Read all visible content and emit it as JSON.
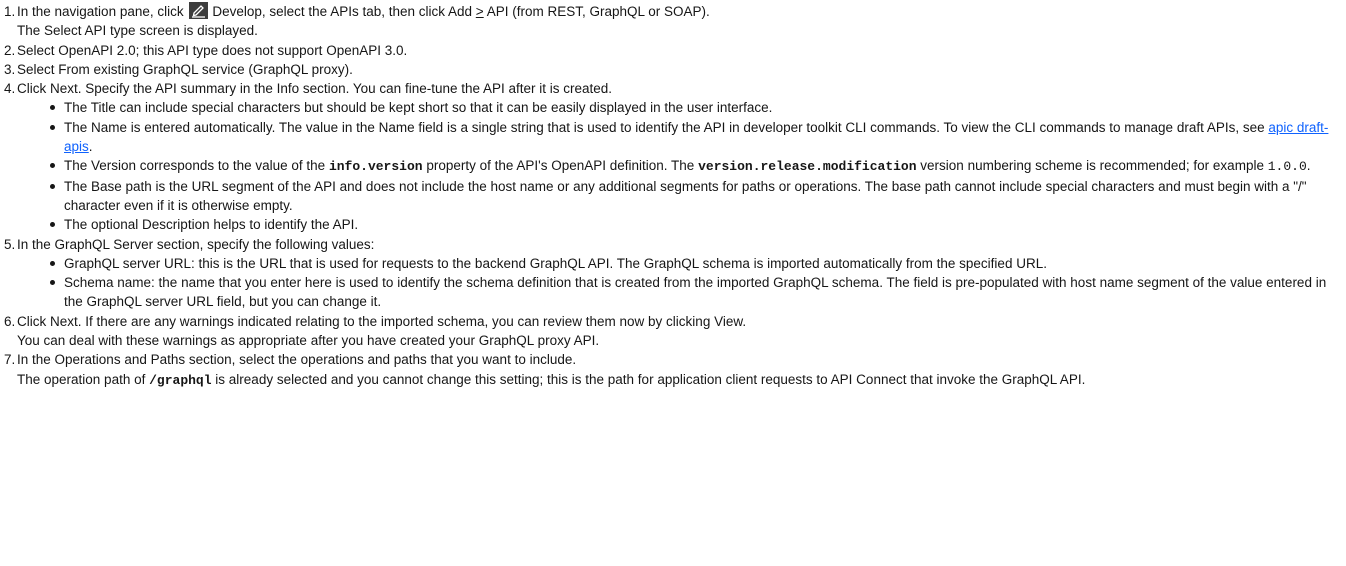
{
  "icons": {
    "develop": "pencil-icon"
  },
  "steps": [
    {
      "num": "1.",
      "t1": "In the navigation pane, click",
      "t2": "Develop, select the APIs tab, then click Add",
      "t3": ">",
      "t4": "API (from REST, GraphQL or SOAP).",
      "line2": "The Select API type screen is displayed."
    },
    {
      "num": "2.",
      "text": "Select OpenAPI 2.0; this API type does not support OpenAPI 3.0."
    },
    {
      "num": "3.",
      "text": "Select From existing GraphQL service (GraphQL proxy)."
    },
    {
      "num": "4.",
      "text": "Click Next. Specify the API summary in the Info section. You can fine-tune the API after it is created.",
      "bullets": {
        "title": "The Title can include special characters but should be kept short so that it can be easily displayed in the user interface.",
        "name_pre": "The Name is entered automatically. The value in the Name field is a single string that is used to identify the API in developer toolkit CLI commands. To view the CLI commands to manage draft APIs, see",
        "name_link": "apic draft-apis",
        "name_post": ".",
        "version_a": "The Version corresponds to the value of the",
        "version_code1": "info.version",
        "version_b": "property of the API's OpenAPI definition. The",
        "version_code2": "version.release.modification",
        "version_c": "version numbering scheme is recommended; for example",
        "version_code3": "1.0.0",
        "version_d": ".",
        "basepath": "The Base path is the URL segment of the API and does not include the host name or any additional segments for paths or operations. The base path cannot include special characters and must begin with a \"/\" character even if it is otherwise empty.",
        "description": "The optional Description helps to identify the API."
      }
    },
    {
      "num": "5.",
      "text": "In the GraphQL Server section, specify the following values:",
      "bullets": {
        "server_url": "GraphQL server URL: this is the URL that is used for requests to the backend GraphQL API. The GraphQL schema is imported automatically from the specified URL.",
        "schema_name": "Schema name: the name that you enter here is used to identify the schema definition that is created from the imported GraphQL schema. The field is pre-populated with host name segment of the value entered in the GraphQL server URL field, but you can change it."
      }
    },
    {
      "num": "6.",
      "text": "Click Next. If there are any warnings indicated relating to the imported schema, you can review them now by clicking View.",
      "line2": "You can deal with these warnings as appropriate after you have created your GraphQL proxy API."
    },
    {
      "num": "7.",
      "text": "In the Operations and Paths section, select the operations and paths that you want to include.",
      "line2_pre": "The operation path of",
      "line2_code": "/graphql",
      "line2_post": "is already selected and you cannot change this setting; this is the path for application client requests to API Connect that invoke the GraphQL API."
    }
  ]
}
